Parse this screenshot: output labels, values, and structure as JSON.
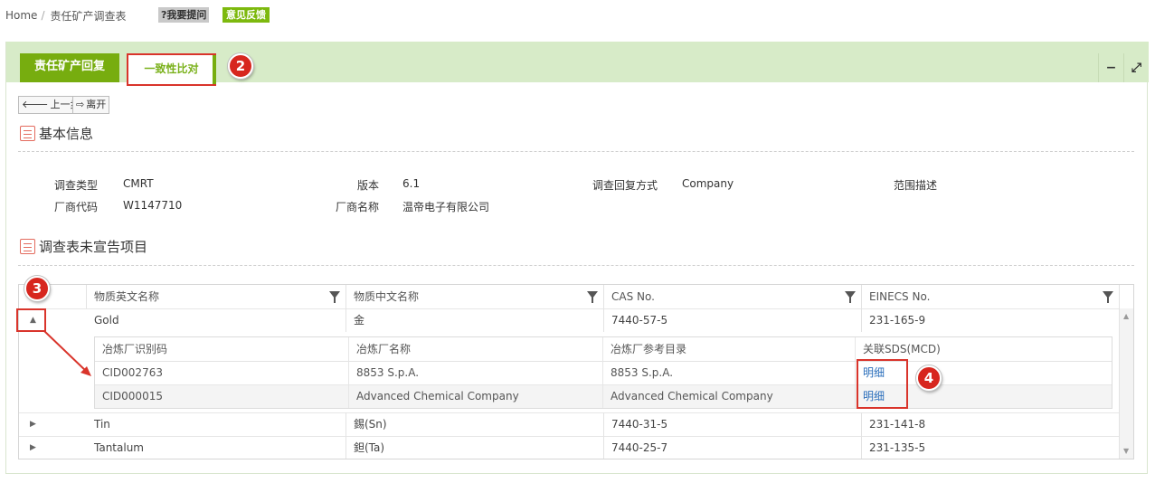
{
  "breadcrumb": {
    "home": "Home",
    "separator": "/",
    "current": "责任矿产调查表"
  },
  "top_buttons": {
    "help": "?我要提问",
    "feedback": "意见反馈"
  },
  "tabs": [
    {
      "label": "责任矿产回复",
      "active": true
    },
    {
      "label": "一致性比对",
      "active": false
    }
  ],
  "panel_tools": {
    "minimize": "−",
    "maximize": "⤢"
  },
  "callouts": {
    "tab": "2",
    "expander": "3",
    "detail_links": "4"
  },
  "toolbar": {
    "prev_label": "上一步",
    "leave_label": "离开"
  },
  "basic_info": {
    "title": "基本信息",
    "fields": [
      {
        "label": "调查类型",
        "value": "CMRT"
      },
      {
        "label": "版本",
        "value": "6.1"
      },
      {
        "label": "调查回复方式",
        "value": "Company"
      },
      {
        "label": "范围描述",
        "value": ""
      },
      {
        "label": "厂商代码",
        "value": "W1147710"
      },
      {
        "label": "厂商名称",
        "value": "温帝电子有限公司"
      }
    ]
  },
  "undeclared": {
    "title": "调查表未宣告项目",
    "columns": [
      "物质英文名称",
      "物质中文名称",
      "CAS No.",
      "EINECS No."
    ],
    "rows": [
      {
        "en": "Gold",
        "cn": "金",
        "cas": "7440-57-5",
        "einecs": "231-165-9",
        "expanded": true
      },
      {
        "en": "Tin",
        "cn": "錫(Sn)",
        "cas": "7440-31-5",
        "einecs": "231-141-8",
        "expanded": false
      },
      {
        "en": "Tantalum",
        "cn": "鉭(Ta)",
        "cas": "7440-25-7",
        "einecs": "231-135-5",
        "expanded": false
      }
    ],
    "detail_columns": [
      "冶炼厂识别码",
      "冶炼厂名称",
      "冶炼厂参考目录",
      "关联SDS(MCD)"
    ],
    "detail_rows": [
      {
        "id": "CID002763",
        "name": "8853 S.p.A.",
        "ref": "8853 S.p.A.",
        "link": "明细"
      },
      {
        "id": "CID000015",
        "name": "Advanced Chemical Company",
        "ref": "Advanced Chemical Company",
        "link": "明细"
      }
    ]
  },
  "colors": {
    "accent": "#77ad0f",
    "header_bg": "#d7ebc8",
    "callout": "#d7261e",
    "link": "#2a6ebb"
  }
}
